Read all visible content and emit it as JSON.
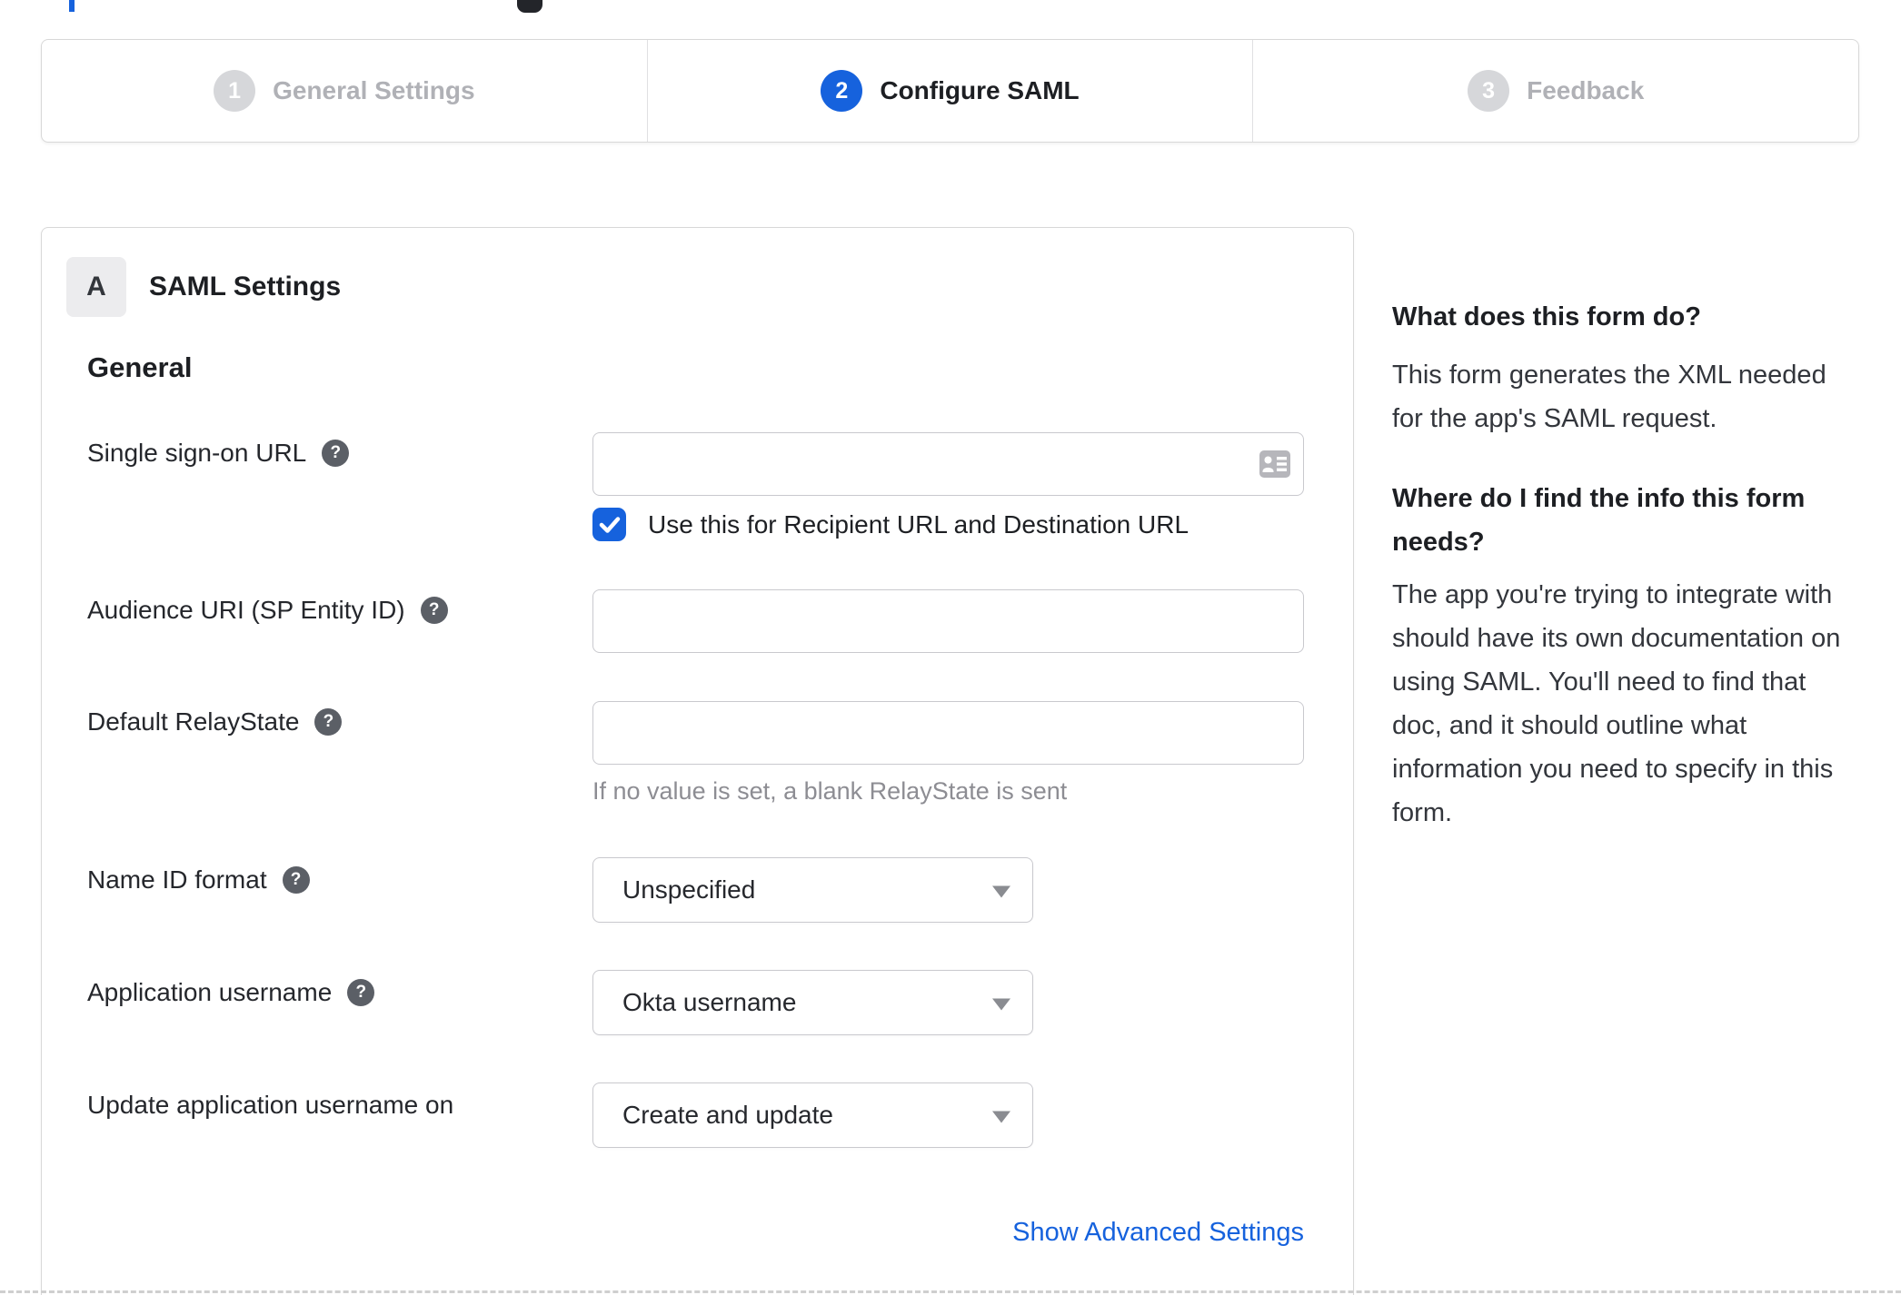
{
  "wizard": {
    "steps": [
      {
        "number": "1",
        "label": "General Settings",
        "state": "inactive"
      },
      {
        "number": "2",
        "label": "Configure SAML",
        "state": "active"
      },
      {
        "number": "3",
        "label": "Feedback",
        "state": "inactive"
      }
    ]
  },
  "panel": {
    "badge": "A",
    "title": "SAML Settings",
    "group": "General"
  },
  "fields": {
    "sso": {
      "label": "Single sign-on URL",
      "value": "",
      "checkbox_label": "Use this for Recipient URL and Destination URL",
      "checkbox_checked": true
    },
    "audience": {
      "label": "Audience URI (SP Entity ID)",
      "value": ""
    },
    "relay": {
      "label": "Default RelayState",
      "value": "",
      "hint": "If no value is set, a blank RelayState is sent"
    },
    "name_id": {
      "label": "Name ID format",
      "value": "Unspecified"
    },
    "app_username": {
      "label": "Application username",
      "value": "Okta username"
    },
    "update_username": {
      "label": "Update application username on",
      "value": "Create and update"
    }
  },
  "advanced": {
    "label": "Show Advanced Settings"
  },
  "sidebar": {
    "sections": [
      {
        "heading": "What does this form do?",
        "body": "This form generates the XML needed for the app's SAML request."
      },
      {
        "heading": "Where do I find the info this form needs?",
        "body": "The app you're trying to integrate with should have its own documentation on using SAML. You'll need to find that doc, and it should outline what information you need to specify in this form."
      }
    ]
  },
  "icons": {
    "help": "?",
    "check": "checkmark",
    "caret": "triangle-down",
    "contact_card": "contact-card"
  },
  "colors": {
    "accent_blue": "#1662dd",
    "inactive_gray": "#b0b1b6",
    "border_gray": "#d8d8d8",
    "hint_gray": "#8d8d93",
    "help_icon_bg": "#5b5f66"
  }
}
